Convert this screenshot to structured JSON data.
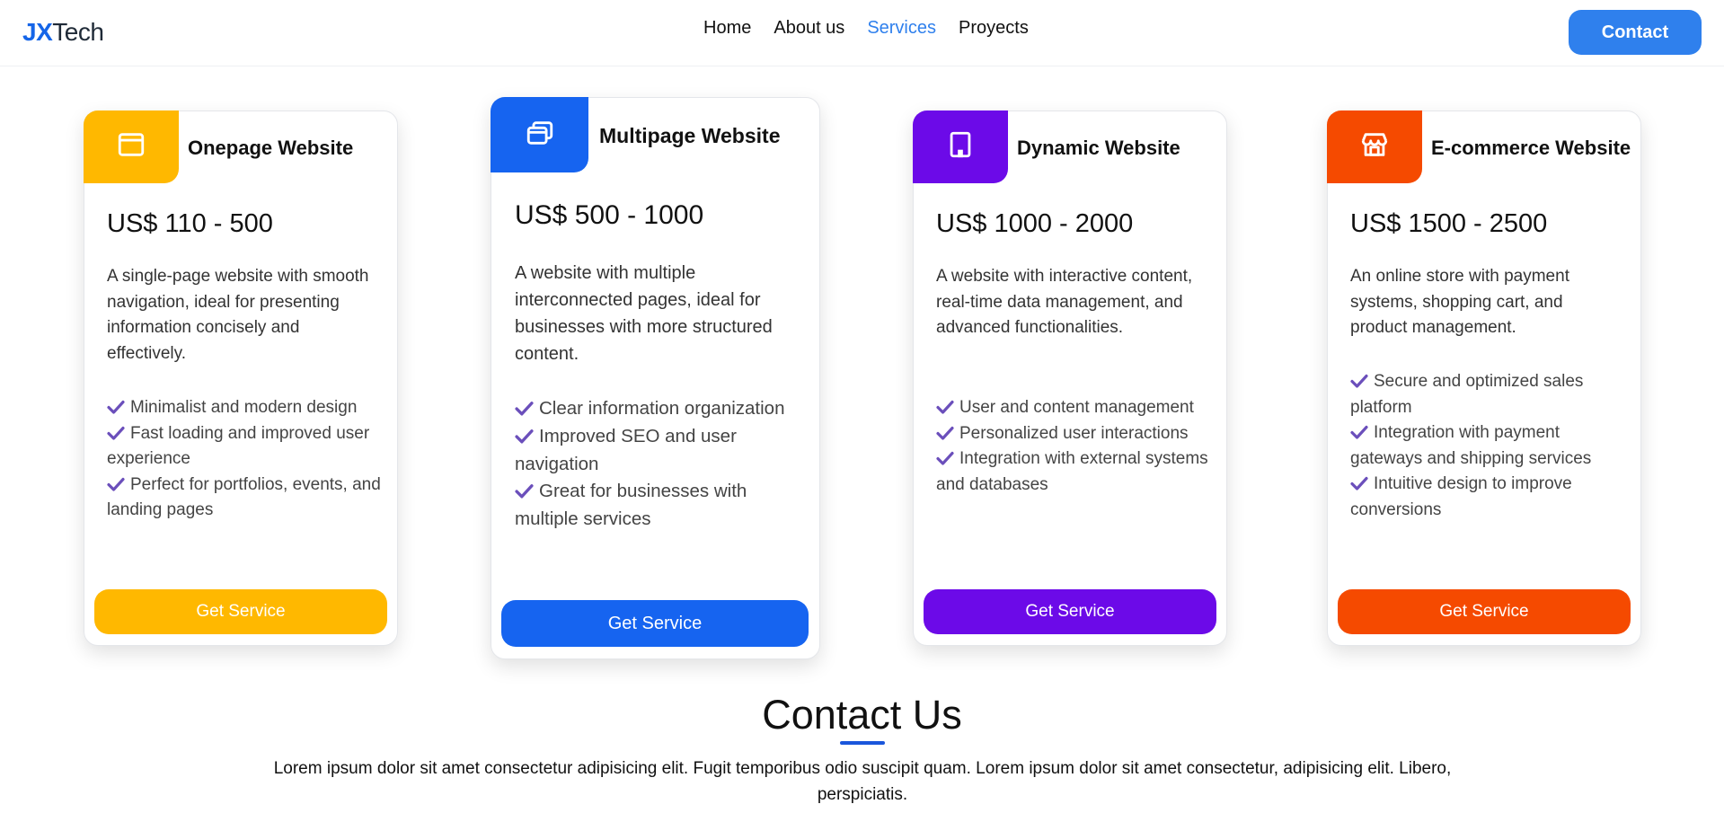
{
  "header": {
    "logo_bold": "JX",
    "logo_rest": "Tech",
    "nav": [
      {
        "label": "Home",
        "active": false
      },
      {
        "label": "About us",
        "active": false
      },
      {
        "label": "Services",
        "active": true
      },
      {
        "label": "Proyects",
        "active": false
      }
    ],
    "contact_label": "Contact",
    "accent_color": "#2f80ed"
  },
  "cards": [
    {
      "title": "Onepage Website",
      "icon": "browser-window-icon",
      "color": "#ffb800",
      "price": "US$ 110 - 500",
      "description": "A single-page website with smooth navigation, ideal for presenting information concisely and effectively.",
      "features": [
        "Minimalist and modern design",
        "Fast loading and improved user experience",
        "Perfect for portfolios, events, and landing pages"
      ],
      "button": "Get Service"
    },
    {
      "title": "Multipage Website",
      "icon": "stacked-windows-icon",
      "color": "#1664f0",
      "price": "US$ 500 - 1000",
      "description": "A website with multiple interconnected pages, ideal for businesses with more structured content.",
      "features": [
        "Clear information organization",
        "Improved SEO and user navigation",
        "Great for businesses with multiple services"
      ],
      "button": "Get Service"
    },
    {
      "title": "Dynamic Website",
      "icon": "building-icon",
      "color": "#6c0ae8",
      "price": "US$ 1000 - 2000",
      "description": "A website with interactive content, real-time data management, and advanced functionalities.",
      "features": [
        "User and content management",
        "Personalized user interactions",
        "Integration with external systems and databases"
      ],
      "button": "Get Service"
    },
    {
      "title": "E-commerce Website",
      "icon": "shop-icon",
      "color": "#f54a00",
      "price": "US$ 1500 - 2500",
      "description": "An online store with payment systems, shopping cart, and product management.",
      "features": [
        "Secure and optimized sales platform",
        "Integration with payment gateways and shipping services",
        "Intuitive design to improve conversions"
      ],
      "button": "Get Service"
    }
  ],
  "contact": {
    "title": "Contact Us",
    "text": "Lorem ipsum dolor sit amet consectetur adipisicing elit. Fugit temporibus odio suscipit quam. Lorem ipsum dolor sit amet consectetur, adipisicing elit. Libero, perspiciatis.",
    "underline_color": "#1a56db"
  },
  "check_color": "#6b4fbb"
}
